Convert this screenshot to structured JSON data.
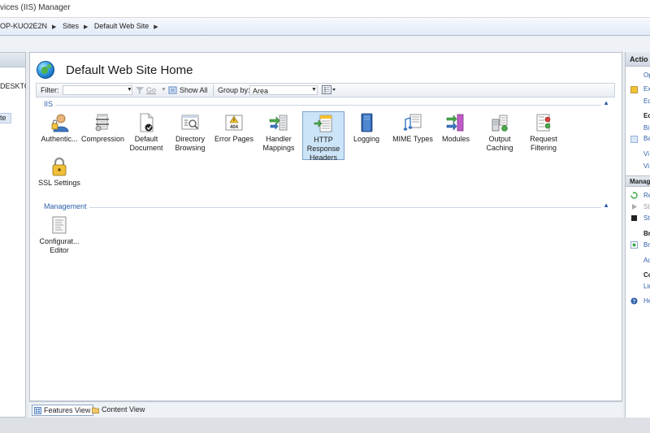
{
  "window": {
    "title": "vices (IIS) Manager"
  },
  "breadcrumb": {
    "items": [
      "OP-KUO2E2N",
      "Sites",
      "Default Web Site"
    ]
  },
  "connections": {
    "node1": "DESKTO",
    "node2": "te"
  },
  "page": {
    "title": "Default Web Site Home"
  },
  "filterbar": {
    "filter_label": "Filter:",
    "go_label": "Go",
    "show_all_label": "Show All",
    "group_by_label": "Group by:",
    "group_by_value": "Area"
  },
  "groups": {
    "iis": "IIS",
    "management": "Management"
  },
  "features": {
    "authentication": [
      "Authentic..."
    ],
    "compression": [
      "Compression"
    ],
    "default_document": [
      "Default",
      "Document"
    ],
    "directory_browsing": [
      "Directory",
      "Browsing"
    ],
    "error_pages": [
      "Error Pages"
    ],
    "handler_mappings": [
      "Handler",
      "Mappings"
    ],
    "http_response_headers": [
      "HTTP",
      "Response",
      "Headers"
    ],
    "logging": [
      "Logging"
    ],
    "mime_types": [
      "MIME Types"
    ],
    "modules": [
      "Modules"
    ],
    "output_caching": [
      "Output",
      "Caching"
    ],
    "request_filtering": [
      "Request",
      "Filtering"
    ],
    "ssl_settings": [
      "SSL Settings"
    ],
    "configuration_editor": [
      "Configurat...",
      "Editor"
    ]
  },
  "error_page_icon_text": "404",
  "views": {
    "features": "Features View",
    "content": "Content View"
  },
  "actions": {
    "header": "Actio",
    "items": [
      "Op",
      "Ex",
      "Ed",
      "Ed",
      "Bi",
      "Ba",
      "Vi",
      "Vi"
    ],
    "manage_header": "Manag",
    "manage_items": [
      "Re",
      "Sta",
      "Sto"
    ],
    "browse_header": "Br",
    "browse_items": [
      "Br",
      "Ad"
    ],
    "config_header": "Co",
    "config_items": [
      "Lin",
      "He"
    ]
  },
  "colors": {
    "accent": "#2d5ea8",
    "selection": "#cce4f7",
    "selection_border": "#7da2ce"
  }
}
